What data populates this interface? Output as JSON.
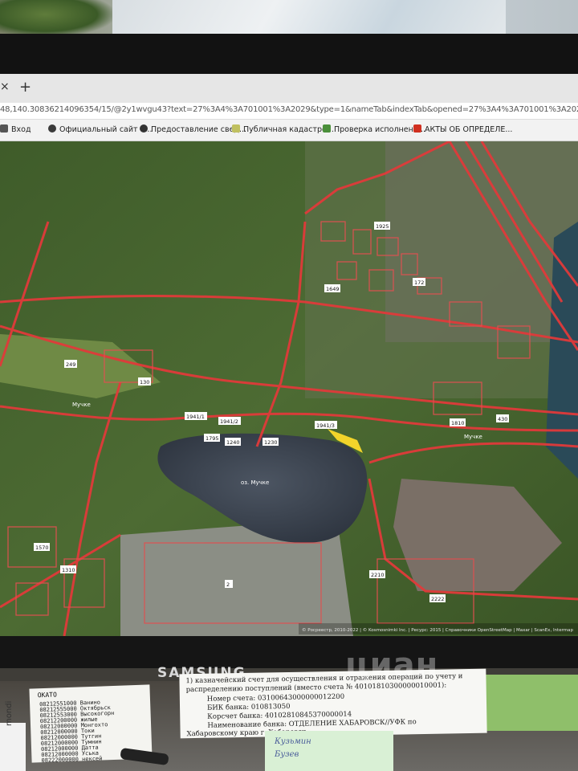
{
  "browser": {
    "tab_close": "×",
    "tab_new": "+",
    "url": "48,140.30836214096354/15/@2y1wvgu43?text=27%3A4%3A701001%3A2029&type=1&nameTab&indexTab&opened=27%3A4%3A701001%3A2029",
    "bookmarks": [
      {
        "label": "Вход",
        "icon_color": "#555555"
      },
      {
        "label": "Официальный сайт а...",
        "icon_color": "#3a3a3a"
      },
      {
        "label": "Предоставление свед...",
        "icon_color": "#333333"
      },
      {
        "label": "Публичная кадастро...",
        "icon_color": "#c0c060"
      },
      {
        "label": "Проверка исполнени...",
        "icon_color": "#4b8f3a"
      },
      {
        "label": "АКТЫ ОБ ОПРЕДЕЛЕ...",
        "icon_color": "#d03020"
      }
    ]
  },
  "map": {
    "lake_label": "оз. Мучке",
    "road_labels": [
      "Мучке",
      "Мучке"
    ],
    "plot_labels": [
      "1925",
      "1941/1",
      "1941/2",
      "1941/3",
      "1795",
      "1240",
      "1230",
      "1649",
      "1810",
      "172",
      "430",
      "2210",
      "2222",
      "1570",
      "1310",
      "2",
      "249",
      "130"
    ],
    "attribution": "© Росреестр, 2010-2022 | © Kosmosnimki Inc. | Ресурс: 2015 | Справочники OpenStreetMap | Maxar | ScanEx, Intermap",
    "overlay_color": "#e03a3a",
    "highlight_color": "#f2d42a"
  },
  "monitor": {
    "brand": "SAMSUNG"
  },
  "desk": {
    "receipt_header": "ОКАТО",
    "receipt_lines": [
      "08212551000 Ванино",
      "08212555000 Октябрьск",
      "08212553000 Высокогорн",
      "08212200000 жилые",
      "08212000000 Монгохто",
      "08212000000 Токи",
      "08212000000 Тутгин",
      "08212000000 Тумнин",
      "08212000000 Датта",
      "08212000000 Уська",
      "08222000000 нексей"
    ],
    "notice_lines": [
      "1) казначейский счет для осуществления и отражения операций по учету и",
      "распределению поступлений (вместо счета № 40101810300000010001):",
      "Номер счета: 03100643000000012200",
      "БИК банка: 010813050",
      "Корсчет банка: 40102810845370000014",
      "Наименование банка: ОТДЕЛЕНИЕ ХАБАРОВСК//УФК по",
      "Хабаровскому краю г. Хабаровск"
    ],
    "handwritten": [
      "Кузьмин",
      "Бузев"
    ],
    "binder_label": "mondi",
    "watermark": "циан"
  }
}
